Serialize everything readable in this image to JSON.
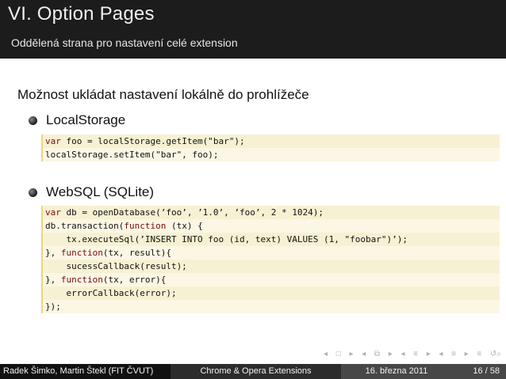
{
  "header": {
    "title": "VI. Option Pages",
    "subtitle": "Oddělená strana pro nastavení celé extension"
  },
  "content": {
    "intro": "Možnost ukládat nastavení lokálně do prohlížeče",
    "localstorage": {
      "label": "LocalStorage",
      "code": [
        [
          {
            "t": "var",
            "c": "kw"
          },
          {
            "t": " foo = localStorage.getItem(\"bar\");"
          }
        ],
        [
          {
            "t": "localStorage.setItem(\"bar\", foo);"
          }
        ]
      ]
    },
    "websql": {
      "label": "WebSQL (SQLite)",
      "code": [
        [
          {
            "t": "var",
            "c": "kw"
          },
          {
            "t": " db = openDatabase(’foo’, ’1.0’, ’foo’, 2 * 1024);"
          }
        ],
        [
          {
            "t": "db.transaction("
          },
          {
            "t": "function",
            "c": "kw"
          },
          {
            "t": " (tx) {"
          }
        ],
        [
          {
            "t": "    tx.executeSql(’INSERT INTO foo (id, text) VALUES (1, \"foobar\")’);"
          }
        ],
        [
          {
            "t": "}, "
          },
          {
            "t": "function",
            "c": "kw"
          },
          {
            "t": "(tx, result){"
          }
        ],
        [
          {
            "t": "    sucessCallback(result);"
          }
        ],
        [
          {
            "t": "}, "
          },
          {
            "t": "function",
            "c": "kw"
          },
          {
            "t": "(tx, error){"
          }
        ],
        [
          {
            "t": "    errorCallback(error);"
          }
        ],
        [
          {
            "t": "});"
          }
        ]
      ]
    }
  },
  "footer": {
    "authors": "Radek Šimko, Martin Štekl  (FIT ČVUT)",
    "course": "Chrome & Opera Extensions",
    "date": "16. března 2011",
    "page": "16 / 58"
  },
  "nav_icons": [
    "nav-frame-left-icon",
    "nav-frame-right-icon",
    "nav-subsection-left-icon",
    "nav-subsection-right-icon",
    "nav-section-left-icon",
    "nav-section-right-icon",
    "nav-align-icon",
    "nav-search-icon"
  ],
  "colors": {
    "header_bg": "#1c1c1c",
    "code_bg": "#f7f1d3",
    "code_border": "#e8d684",
    "keyword": "#7a0b0b"
  }
}
